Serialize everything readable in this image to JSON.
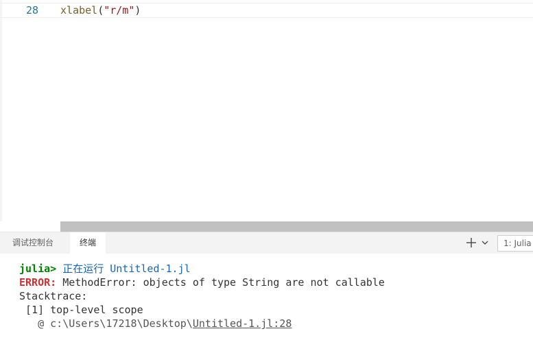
{
  "editor": {
    "line_number": "28",
    "code": {
      "fn": "xlabel",
      "open": "(",
      "str": "\"r/m\"",
      "close": ")"
    }
  },
  "panel": {
    "tabs": [
      {
        "label": "调试控制台",
        "active": false
      },
      {
        "label": "终端",
        "active": true
      }
    ],
    "terminal_select": "1: Julia"
  },
  "terminal": {
    "prompt": "julia>",
    "running_text": " 正在运行 Untitled-1.jl",
    "error_label": "ERROR:",
    "error_message": " MethodError: objects of type String are not callable",
    "stacktrace_label": "Stacktrace:",
    "frame": " [1] top-level scope",
    "at_prefix": "   @ c:\\Users\\17218\\Desktop\\",
    "location_link": "Untitled-1.jl:28"
  },
  "colors": {
    "prompt": "#008000",
    "error": "#cd3131",
    "running": "#1565c0",
    "line_number": "#237893"
  },
  "icons": {
    "new_terminal": "plus-icon",
    "dropdown": "chevron-down-icon"
  }
}
